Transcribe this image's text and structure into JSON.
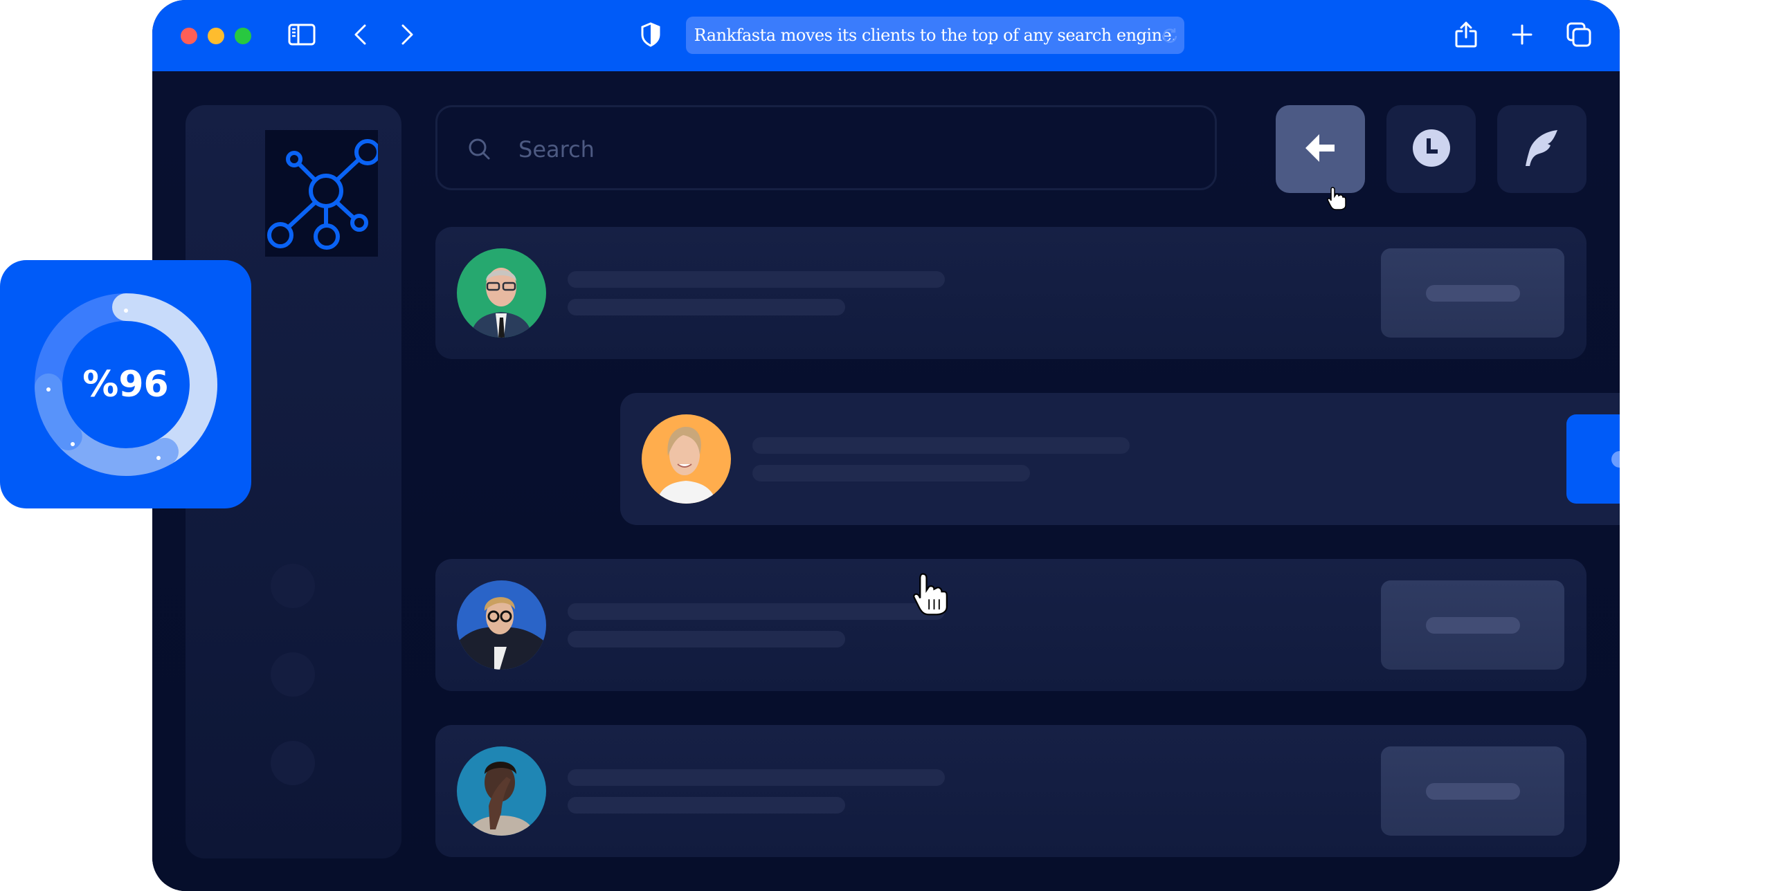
{
  "browser": {
    "address_text": "Rankfasta moves its clients to the top of any search engine.",
    "traffic_lights": {
      "close": "#fe5f57",
      "minimize": "#febc2e",
      "zoom": "#28c840"
    },
    "accent_color": "#005bf8",
    "icons": {
      "sidebar_toggle": "sidebar-icon",
      "back": "chevron-left-icon",
      "forward": "chevron-right-icon",
      "privacy": "shield-icon",
      "reload": "reload-icon",
      "share": "share-icon",
      "new_tab": "plus-icon",
      "tabs": "tabs-icon"
    }
  },
  "app": {
    "logo": "network-hub-icon",
    "search": {
      "placeholder": "Search",
      "value": ""
    },
    "actions": [
      {
        "name": "back-arrow",
        "icon": "arrow-left-icon",
        "active": true
      },
      {
        "name": "history",
        "icon": "clock-icon",
        "active": false
      },
      {
        "name": "write",
        "icon": "feather-icon",
        "active": false
      }
    ],
    "rows": [
      {
        "avatar_bg": "#26a86f",
        "person": "man-grey-hair-glasses-suit",
        "highlighted": false
      },
      {
        "avatar_bg": "#ffad4d",
        "person": "woman-blonde-smiling",
        "highlighted": true
      },
      {
        "avatar_bg": "#2a64c8",
        "person": "man-blond-glasses-blazer",
        "highlighted": false
      },
      {
        "avatar_bg": "#1f86b4",
        "person": "man-hand-over-face",
        "highlighted": false
      }
    ],
    "sidebar_dots": 3
  },
  "stats": {
    "label": "%96",
    "progress_percent": 96
  }
}
